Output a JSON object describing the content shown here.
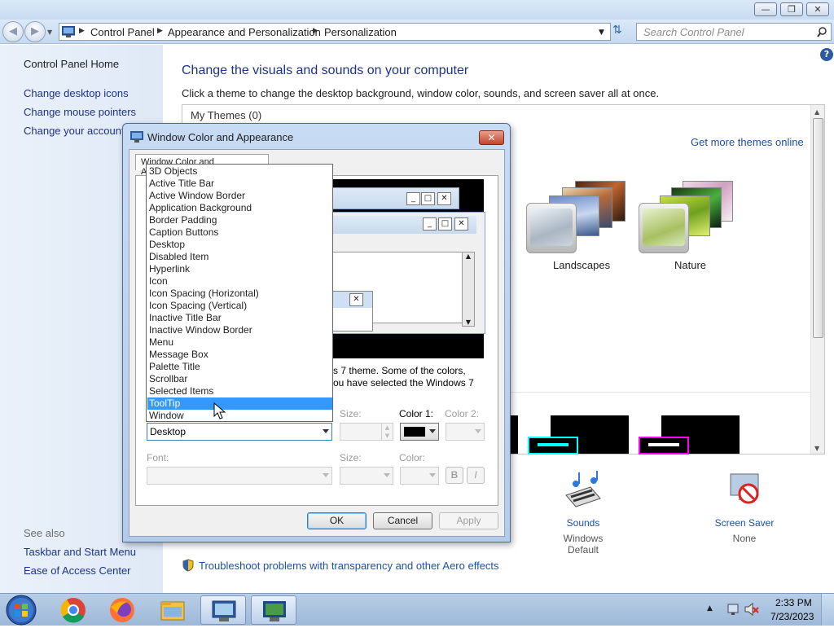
{
  "window": {
    "address_crumbs": [
      "Control Panel",
      "Appearance and Personalization",
      "Personalization"
    ],
    "search_placeholder": "Search Control Panel"
  },
  "sidebar": {
    "links": [
      "Control Panel Home",
      "Change desktop icons",
      "Change mouse pointers",
      "Change your account picture"
    ],
    "see_also_label": "See also",
    "see_also": [
      "Taskbar and Start Menu",
      "Ease of Access Center"
    ]
  },
  "main": {
    "heading": "Change the visuals and sounds on your computer",
    "subheading": "Click a theme to change the desktop background, window color, sounds, and screen saver all at once.",
    "my_themes": "My Themes (0)",
    "get_more": "Get more themes online",
    "themes": [
      "Landscapes",
      "Nature"
    ],
    "sounds_label": "Sounds",
    "sounds_value": "Windows Default",
    "saver_label": "Screen Saver",
    "saver_value": "None",
    "troubleshoot": "Troubleshoot problems with transparency and other Aero effects"
  },
  "dialog": {
    "title": "Window Color and Appearance",
    "tab": "Window Color and Appearance",
    "info_line1": "s 7 theme.  Some of the colors,",
    "info_line2": "ou have selected the Windows 7",
    "item_selected": "Desktop",
    "item_list": [
      "3D Objects",
      "Active Title Bar",
      "Active Window Border",
      "Application Background",
      "Border Padding",
      "Caption Buttons",
      "Desktop",
      "Disabled Item",
      "Hyperlink",
      "Icon",
      "Icon Spacing (Horizontal)",
      "Icon Spacing (Vertical)",
      "Inactive Title Bar",
      "Inactive Window Border",
      "Menu",
      "Message Box",
      "Palette Title",
      "Scrollbar",
      "Selected Items",
      "ToolTip",
      "Window"
    ],
    "highlighted_index": 19,
    "size_label": "Size:",
    "color1_label": "Color 1:",
    "color2_label": "Color 2:",
    "font_label": "Font:",
    "font_size_label": "Size:",
    "font_color_label": "Color:",
    "bold_label": "B",
    "italic_label": "I",
    "ok": "OK",
    "cancel": "Cancel",
    "apply": "Apply"
  },
  "taskbar": {
    "time": "2:33 PM",
    "date": "7/23/2023"
  }
}
